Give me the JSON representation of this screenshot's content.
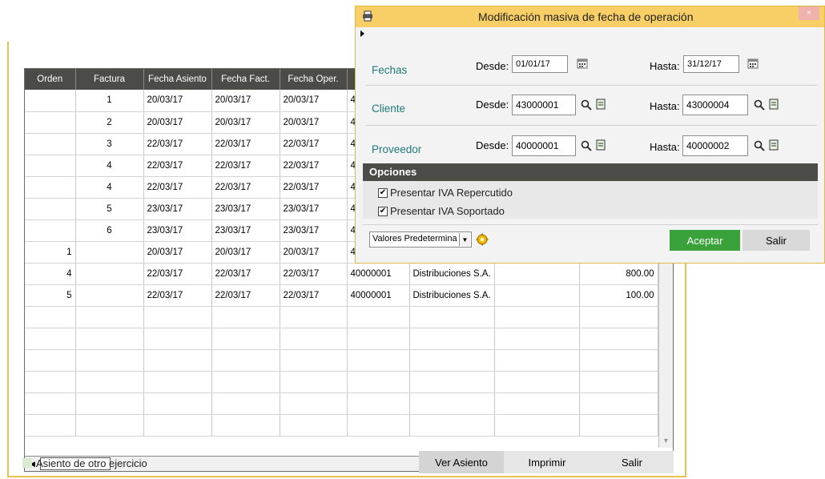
{
  "grid": {
    "columns": [
      "Orden",
      "Factura",
      "Fecha Asiento",
      "Fecha Fact.",
      "Fecha Oper.",
      "",
      "",
      "",
      ""
    ],
    "rows": [
      [
        "",
        "1",
        "20/03/17",
        "20/03/17",
        "20/03/17",
        "4",
        "",
        "",
        ""
      ],
      [
        "",
        "2",
        "20/03/17",
        "20/03/17",
        "20/03/17",
        "4",
        "",
        "",
        ""
      ],
      [
        "",
        "3",
        "22/03/17",
        "22/03/17",
        "22/03/17",
        "4",
        "",
        "",
        ""
      ],
      [
        "",
        "4",
        "22/03/17",
        "22/03/17",
        "22/03/17",
        "4",
        "",
        "",
        ""
      ],
      [
        "",
        "4",
        "22/03/17",
        "22/03/17",
        "22/03/17",
        "4",
        "",
        "",
        ""
      ],
      [
        "",
        "5",
        "23/03/17",
        "23/03/17",
        "23/03/17",
        "4",
        "",
        "",
        ""
      ],
      [
        "",
        "6",
        "23/03/17",
        "23/03/17",
        "23/03/17",
        "4",
        "",
        "",
        ""
      ],
      [
        "1",
        "",
        "20/03/17",
        "20/03/17",
        "20/03/17",
        "4",
        "",
        "",
        ""
      ],
      [
        "4",
        "",
        "22/03/17",
        "22/03/17",
        "22/03/17",
        "40000001",
        "Distribuciones S.A.",
        "",
        "800.00"
      ],
      [
        "5",
        "",
        "22/03/17",
        "22/03/17",
        "22/03/17",
        "40000001",
        "Distribuciones S.A.",
        "",
        "100.00"
      ],
      [
        "",
        "",
        "",
        "",
        "",
        "",
        "",
        "",
        ""
      ],
      [
        "",
        "",
        "",
        "",
        "",
        "",
        "",
        "",
        ""
      ],
      [
        "",
        "",
        "",
        "",
        "",
        "",
        "",
        "",
        ""
      ],
      [
        "",
        "",
        "",
        "",
        "",
        "",
        "",
        "",
        ""
      ],
      [
        "",
        "",
        "",
        "",
        "",
        "",
        "",
        "",
        ""
      ],
      [
        "",
        "",
        "",
        "",
        "",
        "",
        "",
        "",
        ""
      ]
    ]
  },
  "legend": {
    "text": "Asiento de otro ejercicio",
    "color": "#d9ecd2"
  },
  "main_buttons": {
    "ver_asiento": "Ver Asiento",
    "imprimir": "Imprimir",
    "salir": "Salir"
  },
  "dialog": {
    "title": "Modificación masiva de fecha de operación",
    "close_glyph": "×",
    "fechas": {
      "label": "Fechas",
      "desde_label": "Desde:",
      "desde": "01/01/17",
      "hasta_label": "Hasta:",
      "hasta": "31/12/17"
    },
    "cliente": {
      "label": "Cliente",
      "desde_label": "Desde:",
      "desde": "43000001",
      "hasta_label": "Hasta:",
      "hasta": "43000004"
    },
    "proveedor": {
      "label": "Proveedor",
      "desde_label": "Desde:",
      "desde": "40000001",
      "hasta_label": "Hasta:",
      "hasta": "40000002"
    },
    "opciones": {
      "title": "Opciones",
      "items": [
        {
          "label": "Presentar IVA Repercutido",
          "checked": true
        },
        {
          "label": "Presentar IVA Soportado",
          "checked": true
        }
      ]
    },
    "preset_select": "Valores Predetermina",
    "accept": "Aceptar",
    "exit": "Salir"
  },
  "colors": {
    "accent_border": "#e8c24f",
    "title_bar": "#f7cf66",
    "header_dark": "#4b4b48",
    "accept_green": "#3aa23a",
    "section_label": "#1f7a7a"
  }
}
